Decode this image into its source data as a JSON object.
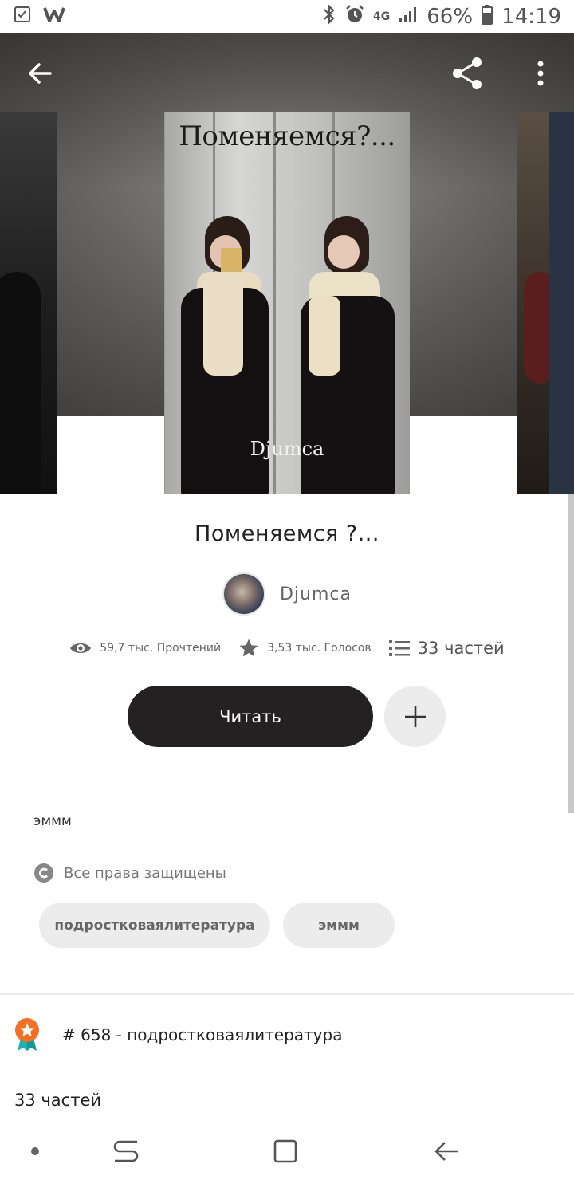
{
  "status_bar": {
    "network": "4G",
    "battery": "66%",
    "time": "14:19"
  },
  "story": {
    "cover_title": "Поменяемся?...",
    "cover_author": "Djumca",
    "title": "Поменяемся ?...",
    "author": "Djumca",
    "reads": "59,7 тыс. Прочтений",
    "votes": "3,53 тыс. Голосов",
    "parts": "33 частей",
    "read_button": "Читать",
    "description": "эммм",
    "rights": "Все права защищены",
    "tags": [
      "подростковаялитература",
      "эммм"
    ],
    "rank": "# 658 - подростковаялитература",
    "parts_label": "33 частей"
  },
  "icons": {
    "back": "arrow-left",
    "share": "share",
    "more": "more-vertical",
    "reads": "eye",
    "votes": "star",
    "parts": "list",
    "add": "plus",
    "rights": "copyright",
    "rank": "medal"
  },
  "colors": {
    "read_button": "#232122",
    "tag_bg": "#ececec",
    "medal": "#f36f21",
    "medal_ribbon": "#1ab4b4"
  }
}
